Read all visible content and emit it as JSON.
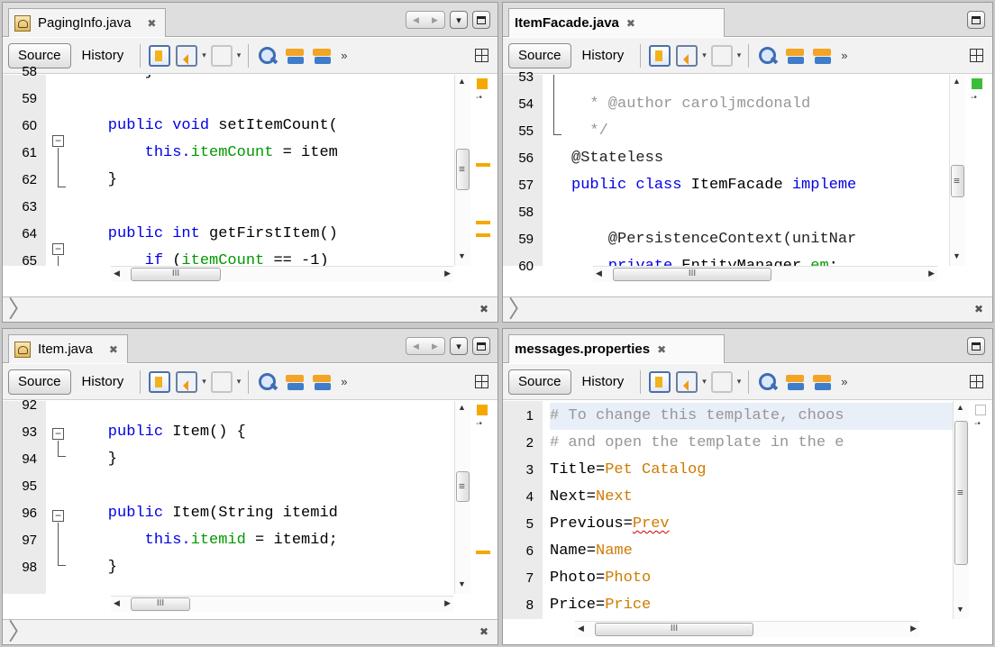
{
  "common": {
    "source_label": "Source",
    "history_label": "History",
    "tab_close_glyph": "✖",
    "more_glyph": "»",
    "split_glyph": "⊞",
    "output_close_glyph": "✖",
    "output_chevron": "〉",
    "hthumb_glyph": "III",
    "up_glyph": "▲",
    "down_glyph": "▼",
    "left_glyph": "◀",
    "right_glyph": "▶",
    "dd_glyph": "▾"
  },
  "panes": [
    {
      "tab_title": "PagingInfo.java",
      "lines": [
        {
          "n": "58",
          "t": [
            {
              "c": "pl",
              "s": "        }"
            }
          ]
        },
        {
          "n": "59",
          "t": []
        },
        {
          "n": "60",
          "t": [
            {
              "c": "kw",
              "s": "    public void "
            },
            {
              "c": "pl",
              "s": "setItemCount("
            }
          ]
        },
        {
          "n": "61",
          "t": [
            {
              "c": "kw",
              "s": "        this."
            },
            {
              "c": "fld",
              "s": "itemCount"
            },
            {
              "c": "pl",
              "s": " = item"
            }
          ]
        },
        {
          "n": "62",
          "t": [
            {
              "c": "pl",
              "s": "    }"
            }
          ]
        },
        {
          "n": "63",
          "t": []
        },
        {
          "n": "64",
          "t": [
            {
              "c": "kw",
              "s": "    public int "
            },
            {
              "c": "pl",
              "s": "getFirstItem()"
            }
          ]
        },
        {
          "n": "65",
          "t": [
            {
              "c": "kw",
              "s": "        if "
            },
            {
              "c": "pl",
              "s": "("
            },
            {
              "c": "fld",
              "s": "itemCount"
            },
            {
              "c": "pl",
              "s": " == -1)"
            }
          ]
        }
      ]
    },
    {
      "tab_title": "ItemFacade.java",
      "lines": [
        {
          "n": "53",
          "t": [
            {
              "c": "cm",
              "s": "  *"
            }
          ]
        },
        {
          "n": "54",
          "t": [
            {
              "c": "cm",
              "s": "  * @author caroljmcdonald"
            }
          ]
        },
        {
          "n": "55",
          "t": [
            {
              "c": "cm",
              "s": "  */"
            }
          ]
        },
        {
          "n": "56",
          "t": [
            {
              "c": "ann",
              "s": "@Stateless"
            }
          ]
        },
        {
          "n": "57",
          "t": [
            {
              "c": "kw",
              "s": "public class "
            },
            {
              "c": "pl",
              "s": "ItemFacade "
            },
            {
              "c": "kw",
              "s": "impleme"
            }
          ]
        },
        {
          "n": "58",
          "t": []
        },
        {
          "n": "59",
          "t": [
            {
              "c": "ann",
              "s": "    @PersistenceContext(unitNar"
            }
          ]
        },
        {
          "n": "60",
          "t": [
            {
              "c": "kw",
              "s": "    private "
            },
            {
              "c": "pl",
              "s": "EntityManager "
            },
            {
              "c": "fld",
              "s": "em"
            },
            {
              "c": "pl",
              "s": ";"
            }
          ]
        }
      ]
    },
    {
      "tab_title": "Item.java",
      "lines": [
        {
          "n": "92",
          "t": []
        },
        {
          "n": "93",
          "t": [
            {
              "c": "kw",
              "s": "    public "
            },
            {
              "c": "pl",
              "s": "Item() {"
            }
          ]
        },
        {
          "n": "94",
          "t": [
            {
              "c": "pl",
              "s": "    }"
            }
          ]
        },
        {
          "n": "95",
          "t": []
        },
        {
          "n": "96",
          "t": [
            {
              "c": "kw",
              "s": "    public "
            },
            {
              "c": "pl",
              "s": "Item(String itemid"
            }
          ]
        },
        {
          "n": "97",
          "t": [
            {
              "c": "kw",
              "s": "        this."
            },
            {
              "c": "fld",
              "s": "itemid"
            },
            {
              "c": "pl",
              "s": " = itemid;"
            }
          ]
        },
        {
          "n": "98",
          "t": [
            {
              "c": "pl",
              "s": "    }"
            }
          ]
        }
      ]
    },
    {
      "tab_title": "messages.properties",
      "lines": [
        {
          "n": "1",
          "t": [
            {
              "c": "cm",
              "s": "# To change this template, choos"
            }
          ]
        },
        {
          "n": "2",
          "t": [
            {
              "c": "cm",
              "s": "# and open the template in the e"
            }
          ]
        },
        {
          "n": "3",
          "t": [
            {
              "c": "pl",
              "s": "Title="
            },
            {
              "c": "val",
              "s": "Pet Catalog"
            }
          ]
        },
        {
          "n": "4",
          "t": [
            {
              "c": "pl",
              "s": "Next="
            },
            {
              "c": "val",
              "s": "Next"
            }
          ]
        },
        {
          "n": "5",
          "t": [
            {
              "c": "pl",
              "s": "Previous="
            },
            {
              "c": "val",
              "s": "Prev"
            }
          ]
        },
        {
          "n": "6",
          "t": [
            {
              "c": "pl",
              "s": "Name="
            },
            {
              "c": "val",
              "s": "Name"
            }
          ]
        },
        {
          "n": "7",
          "t": [
            {
              "c": "pl",
              "s": "Photo="
            },
            {
              "c": "val",
              "s": "Photo"
            }
          ]
        },
        {
          "n": "8",
          "t": [
            {
              "c": "pl",
              "s": "Price="
            },
            {
              "c": "val",
              "s": "Price"
            }
          ]
        }
      ]
    }
  ]
}
